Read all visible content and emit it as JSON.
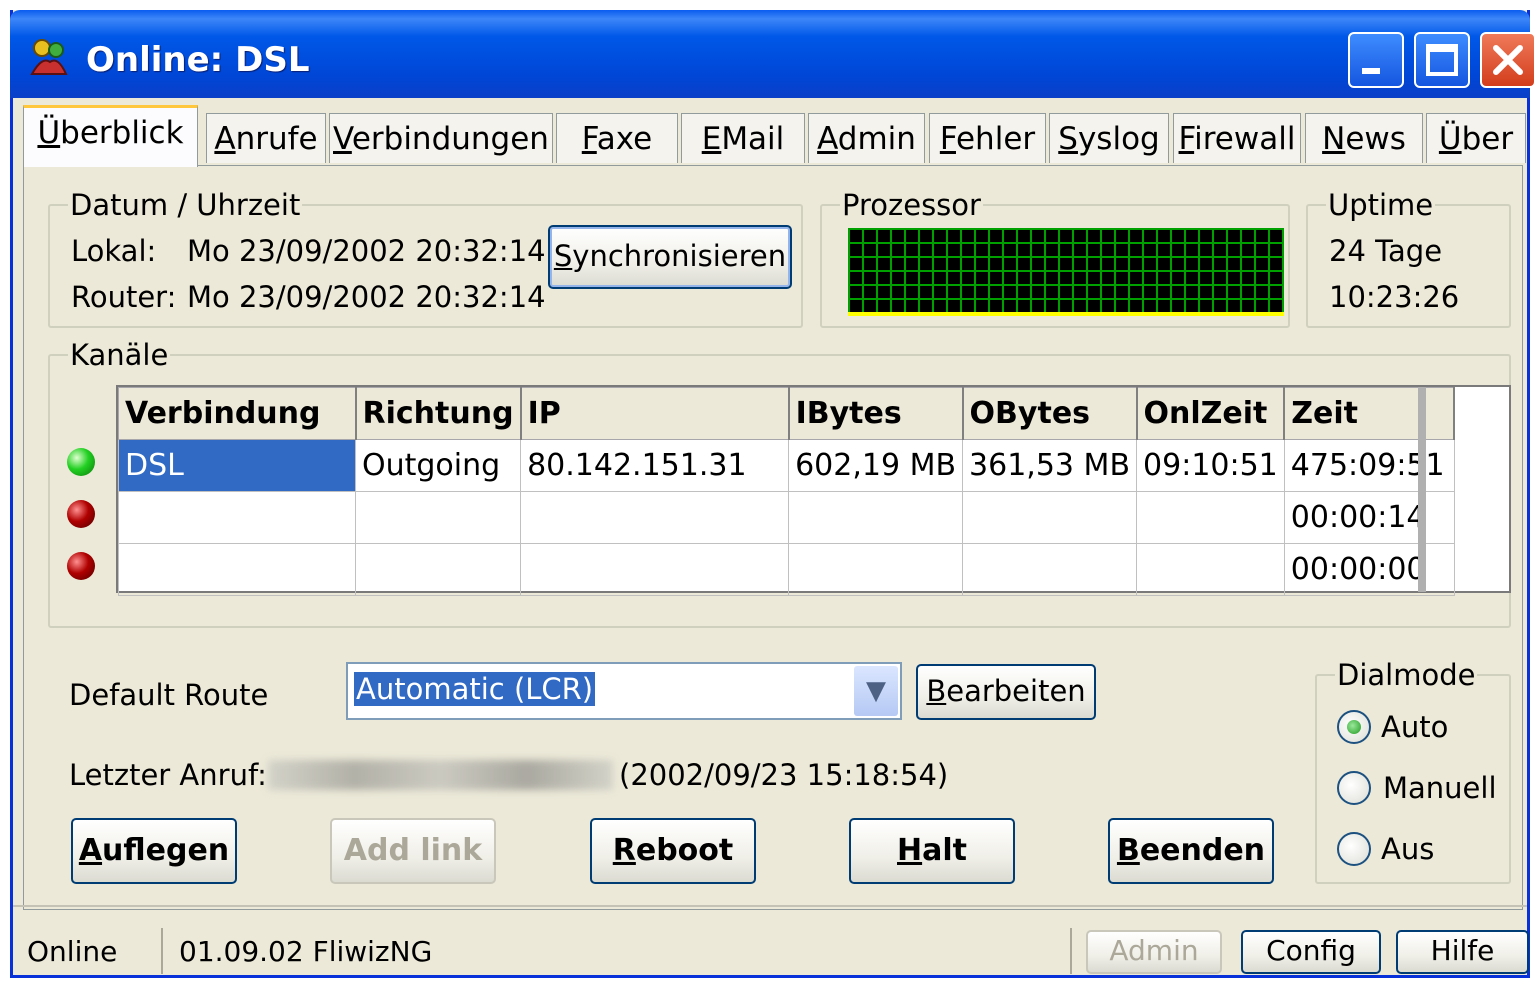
{
  "window": {
    "title": "Online: DSL",
    "controls": [
      "minimize",
      "maximize",
      "close"
    ]
  },
  "tabs": [
    {
      "label": "Überblick",
      "u": "Ü",
      "rest": "berblick",
      "active": true
    },
    {
      "label": "Anrufe",
      "u": "A",
      "rest": "nrufe"
    },
    {
      "label": "Verbindungen",
      "u": "V",
      "rest": "erbindungen"
    },
    {
      "label": "Faxe",
      "u": "F",
      "rest": "axe"
    },
    {
      "label": "EMail",
      "u": "E",
      "rest": "Mail"
    },
    {
      "label": "Admin",
      "u": "A",
      "rest": "dmin"
    },
    {
      "label": "Fehler",
      "u": "F",
      "rest": "ehler"
    },
    {
      "label": "Syslog",
      "u": "S",
      "rest": "yslog"
    },
    {
      "label": "Firewall",
      "u": "F",
      "rest": "irewall"
    },
    {
      "label": "News",
      "u": "N",
      "rest": "ews"
    },
    {
      "label": "Über",
      "u": "Ü",
      "rest": "ber"
    }
  ],
  "datetime": {
    "legend": "Datum / Uhrzeit",
    "local_label": "Lokal:",
    "local_value": "Mo 23/09/2002 20:32:14",
    "router_label": "Router:",
    "router_value": "Mo 23/09/2002 20:32:14",
    "sync_button": "Synchronisieren"
  },
  "processor": {
    "legend": "Prozessor"
  },
  "uptime": {
    "legend": "Uptime",
    "days": "24 Tage",
    "time": "10:23:26"
  },
  "channels": {
    "legend": "Kanäle",
    "columns": [
      "Verbindung",
      "Richtung",
      "IP",
      "IBytes",
      "OBytes",
      "OnlZeit",
      "Zeit"
    ],
    "rows": [
      {
        "status": "green",
        "cells": [
          "DSL",
          "Outgoing",
          "80.142.151.31",
          "602,19 MB",
          "361,53 MB",
          "09:10:51",
          "475:09:51"
        ]
      },
      {
        "status": "red",
        "cells": [
          "",
          "",
          "",
          "",
          "",
          "",
          "00:00:14"
        ]
      },
      {
        "status": "red",
        "cells": [
          "",
          "",
          "",
          "",
          "",
          "",
          "00:00:00"
        ]
      }
    ]
  },
  "route": {
    "label": "Default Route",
    "selected": "Automatic (LCR)",
    "edit_button": "Bearbeiten"
  },
  "last_call": {
    "label": "Letzter Anruf:",
    "timestamp": "(2002/09/23 15:18:54)"
  },
  "actions": {
    "hangup": "Auflegen",
    "add_link": "Add link",
    "reboot": "Reboot",
    "halt": "Halt",
    "exit": "Beenden"
  },
  "dialmode": {
    "legend": "Dialmode",
    "options": [
      "Auto",
      "Manuell",
      "Aus"
    ],
    "selected": "Auto"
  },
  "statusbar": {
    "state": "Online",
    "version": "01.09.02 FliwizNG",
    "admin": "Admin",
    "config": "Config",
    "help": "Hilfe"
  }
}
